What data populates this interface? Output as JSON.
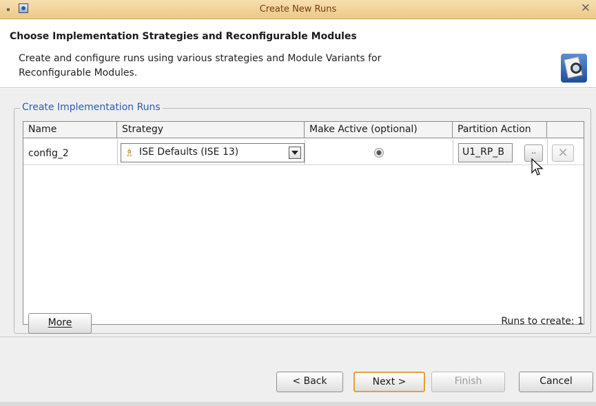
{
  "window": {
    "title": "Create New Runs"
  },
  "header": {
    "title": "Choose Implementation Strategies and Reconfigurable Modules",
    "description_line1": "Create and configure runs using various strategies and Module Variants for",
    "description_line2": "Reconfigurable Modules."
  },
  "group": {
    "title": "Create Implementation Runs"
  },
  "table": {
    "columns": [
      "Name",
      "Strategy",
      "Make Active (optional)",
      "Partition Action",
      ""
    ],
    "rows": [
      {
        "name": "config_2",
        "strategy": "ISE Defaults (ISE 13)",
        "make_active": true,
        "partition_action": "U1_RP_B",
        "browse_label": "..",
        "remove_label": "✕"
      }
    ]
  },
  "buttons": {
    "more": "More",
    "back": "< Back",
    "next": "Next >",
    "finish": "Finish",
    "cancel": "Cancel"
  },
  "status": {
    "runs_to_create": "Runs to create: 1"
  }
}
